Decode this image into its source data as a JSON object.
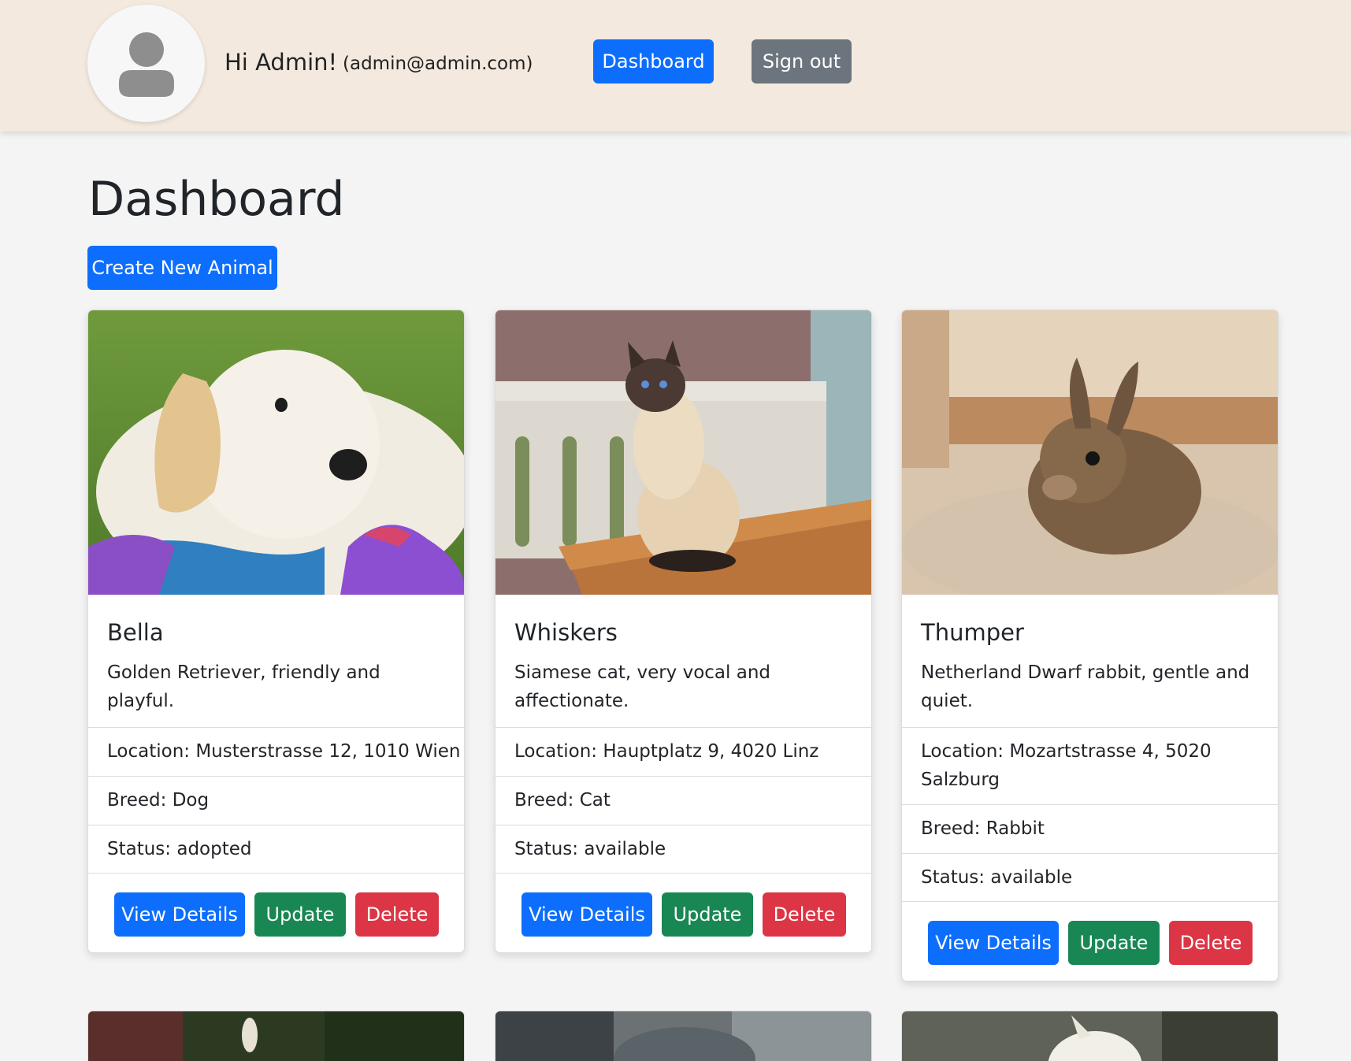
{
  "header": {
    "greeting": "Hi Admin!",
    "email": "(admin@admin.com)",
    "nav": {
      "dashboard_label": "Dashboard",
      "signout_label": "Sign out"
    }
  },
  "main": {
    "title": "Dashboard",
    "create_label": "Create New Animal"
  },
  "animals": [
    {
      "name": "Bella",
      "description": "Golden Retriever, friendly and playful.",
      "location": "Location: Musterstrasse 12, 1010 Wien",
      "breed": "Breed: Dog",
      "status": "Status: adopted"
    },
    {
      "name": "Whiskers",
      "description": "Siamese cat, very vocal and affectionate.",
      "location": "Location: Hauptplatz 9, 4020 Linz",
      "breed": "Breed: Cat",
      "status": "Status: available"
    },
    {
      "name": "Thumper",
      "description": "Netherland Dwarf rabbit, gentle and quiet.",
      "location": "Location: Mozartstrasse 4, 5020 Salzburg",
      "breed": "Breed: Rabbit",
      "status": "Status: available"
    }
  ],
  "card_actions": {
    "view": "View Details",
    "update": "Update",
    "delete": "Delete"
  },
  "colors": {
    "primary": "#0d6efd",
    "secondary": "#6c757d",
    "success": "#198754",
    "danger": "#dc3545",
    "header_bg": "#f3e9de",
    "page_bg": "#f4f4f4"
  }
}
